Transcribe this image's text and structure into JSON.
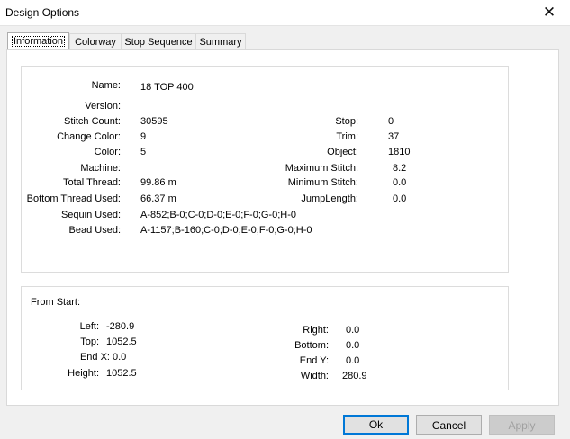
{
  "window": {
    "title": "Design Options",
    "close_glyph": "✕"
  },
  "tabs": [
    {
      "label": "Information"
    },
    {
      "label": "Colorway"
    },
    {
      "label": "Stop Sequence"
    },
    {
      "label": "Summary"
    }
  ],
  "info": {
    "name_label": "Name:",
    "name_value": "18 TOP 400",
    "version_label": "Version:",
    "version_value": "",
    "stitch_count_label": "Stitch Count:",
    "stitch_count_value": "30595",
    "change_color_label": "Change Color:",
    "change_color_value": "9",
    "color_label": "Color:",
    "color_value": "5",
    "machine_label": "Machine:",
    "machine_value": "",
    "total_thread_label": "Total Thread:",
    "total_thread_value": "99.86 m",
    "bottom_thread_label": "Bottom Thread Used:",
    "bottom_thread_value": "66.37 m",
    "sequin_label": "Sequin Used:",
    "sequin_value": "A-852;B-0;C-0;D-0;E-0;F-0;G-0;H-0",
    "bead_label": "Bead Used:",
    "bead_value": "A-1157;B-160;C-0;D-0;E-0;F-0;G-0;H-0",
    "stop_label": "Stop:",
    "stop_value": "0",
    "trim_label": "Trim:",
    "trim_value": "37",
    "object_label": "Object:",
    "object_value": "1810",
    "max_stitch_label": "Maximum Stitch:",
    "max_stitch_value": "8.2",
    "min_stitch_label": "Minimum Stitch:",
    "min_stitch_value": "0.0",
    "jump_length_label": "JumpLength:",
    "jump_length_value": "0.0"
  },
  "from_start": {
    "heading": "From Start:",
    "left_label": "Left:",
    "left_value": "-280.9",
    "top_label": "Top:",
    "top_value": "1052.5",
    "endx_label": "End X:",
    "endx_value": "0.0",
    "height_label": "Height:",
    "height_value": "1052.5",
    "right_label": "Right:",
    "right_value": "0.0",
    "bottom_label": "Bottom:",
    "bottom_value": "0.0",
    "endy_label": "End Y:",
    "endy_value": "0.0",
    "width_label": "Width:",
    "width_value": "280.9"
  },
  "buttons": {
    "ok": "Ok",
    "cancel": "Cancel",
    "apply": "Apply"
  }
}
